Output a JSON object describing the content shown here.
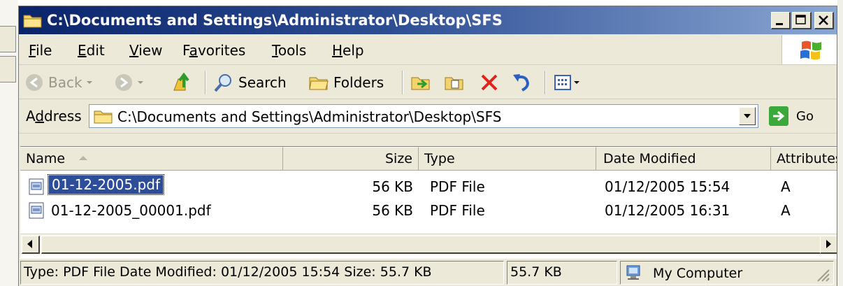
{
  "window": {
    "title": "C:\\Documents and Settings\\Administrator\\Desktop\\SFS",
    "caption_buttons": [
      "minimize",
      "maximize",
      "close"
    ]
  },
  "menu": [
    {
      "pre": "",
      "key": "F",
      "post": "ile"
    },
    {
      "pre": "",
      "key": "E",
      "post": "dit"
    },
    {
      "pre": "",
      "key": "V",
      "post": "iew"
    },
    {
      "pre": "F",
      "key": "a",
      "post": "vorites"
    },
    {
      "pre": "",
      "key": "T",
      "post": "ools"
    },
    {
      "pre": "",
      "key": "H",
      "post": "elp"
    }
  ],
  "toolbar": {
    "back_label": "Back",
    "search_label": "Search",
    "folders_label": "Folders"
  },
  "address": {
    "label_pre": "A",
    "label_key": "d",
    "label_post": "dress",
    "value": "C:\\Documents and Settings\\Administrator\\Desktop\\SFS",
    "go_label": "Go"
  },
  "columns": {
    "name": "Name",
    "size": "Size",
    "type": "Type",
    "date": "Date Modified",
    "attributes": "Attributes"
  },
  "files": [
    {
      "name": "01-12-2005.pdf",
      "size": "56 KB",
      "type": "PDF File",
      "date": "01/12/2005 15:54",
      "attr": "A",
      "selected": true
    },
    {
      "name": "01-12-2005_00001.pdf",
      "size": "56 KB",
      "type": "PDF File",
      "date": "01/12/2005 16:31",
      "attr": "A",
      "selected": false
    }
  ],
  "status": {
    "info": "Type: PDF File Date Modified: 01/12/2005 15:54 Size: 55.7 KB",
    "size": "55.7 KB",
    "zone": "My Computer"
  },
  "colors": {
    "title_start": "#0a246a",
    "title_end": "#8aa6d3",
    "selection": "#2e4d98",
    "face": "#ece9d8"
  }
}
